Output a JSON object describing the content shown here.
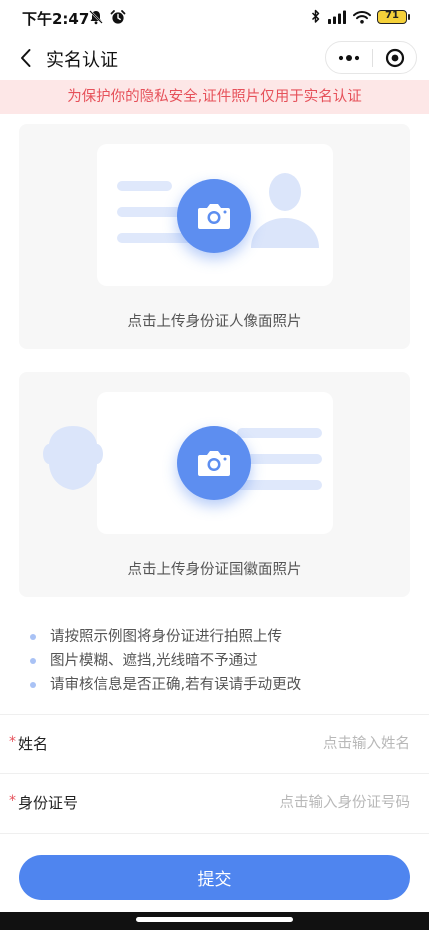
{
  "status_bar": {
    "time": "下午2:47",
    "battery": "71",
    "icons": [
      "bell-mute-icon",
      "alarm-icon",
      "bluetooth-icon",
      "signal-icon",
      "wifi-icon",
      "battery-icon"
    ],
    "battery_color": "#f5d13a"
  },
  "nav": {
    "title": "实名认证",
    "icons": [
      "back-icon",
      "more-icon",
      "close-mini-program-icon"
    ]
  },
  "notice": {
    "text": "为保护你的隐私安全,证件照片仅用于实名认证"
  },
  "upload": {
    "front_caption": "点击上传身份证人像面照片",
    "back_caption": "点击上传身份证国徽面照片",
    "icon": "camera-icon"
  },
  "tips": [
    "请按照示例图将身份证进行拍照上传",
    "图片模糊、遮挡,光线暗不予通过",
    "请审核信息是否正确,若有误请手动更改"
  ],
  "form": {
    "required_mark": "*",
    "name_label": "姓名",
    "name_value": "",
    "name_placeholder": "点击输入姓名",
    "id_label": "身份证号",
    "id_value": "",
    "id_placeholder": "点击输入身份证号码"
  },
  "submit_label": "提交",
  "colors": {
    "accent": "#4f85ef",
    "notice_bg": "#fde7e7",
    "notice_text": "#e6515a",
    "required": "#e6515a"
  }
}
